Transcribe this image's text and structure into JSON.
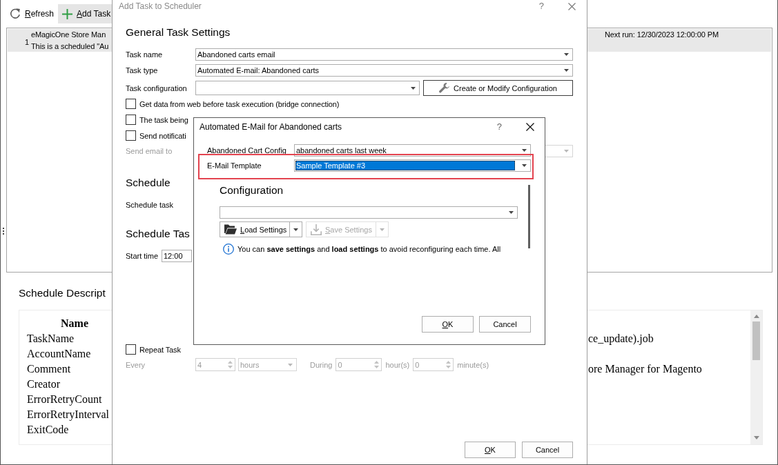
{
  "main_window": {
    "toolbar": [
      {
        "kind": "refresh",
        "label": "Refresh",
        "mnemonic": true,
        "pressed": false
      },
      {
        "kind": "add",
        "label": "Add Task",
        "mnemonic": true,
        "pressed": true
      }
    ],
    "task_list": [
      {
        "number": "1",
        "title": "eMagicOne Store Man",
        "description": "This is a scheduled \"Au",
        "next_run": "Next run: 12/30/2023 12:00:00 PM",
        "selected": true
      }
    ],
    "schedule_description": {
      "title": "Schedule Descript",
      "table": {
        "header": "Name",
        "rows": [
          {
            "name": "TaskName",
            "value": "ce_update).job"
          },
          {
            "name": "AccountName"
          },
          {
            "name": "Comment",
            "value": "ore Manager for Magento"
          },
          {
            "name": "Creator"
          },
          {
            "name": "ErrorRetryCount"
          },
          {
            "name": "ErrorRetryInterval"
          },
          {
            "name": "ExitCode"
          }
        ]
      }
    }
  },
  "scheduler_dialog": {
    "title": "Add Task to Scheduler",
    "help": "?",
    "heading": "General Task Settings",
    "fields": [
      {
        "kind": "dropdown",
        "label": "Task name",
        "value": "Abandoned carts email"
      },
      {
        "kind": "dropdown",
        "label": "Task type",
        "value": "Automated E-mail: Abandoned carts"
      },
      {
        "kind": "dropdown_button",
        "label": "Task configuration",
        "button": "Create or Modify Configuration"
      }
    ],
    "options": [
      {
        "label": "Get data from web before task execution (bridge connection)",
        "checked": false
      },
      {
        "label": "The task being",
        "checked": false
      },
      {
        "label": "Send notificati",
        "checked": false
      }
    ],
    "send_email": {
      "label": "Send email to",
      "disabled": true
    },
    "schedule": {
      "heading": "Schedule",
      "label": "Schedule task"
    },
    "schedule_task": {
      "heading": "Schedule Tas",
      "start_label": "Start time",
      "start_time": "12:00"
    },
    "repeat": {
      "label": "Repeat Task",
      "checked": false,
      "disabled": true,
      "every_label": "Every",
      "every": "4",
      "unit": "hours",
      "during_label": "During",
      "hours": "0",
      "hours_label": "hour(s)",
      "minutes": "0",
      "minutes_label": "minute(s)"
    },
    "buttons": [
      {
        "label": "OK",
        "mnemonic": true
      },
      {
        "label": "Cancel",
        "mnemonic": false
      }
    ]
  },
  "email_dialog": {
    "title": "Automated E-Mail for Abandoned carts",
    "help": "?",
    "fields": [
      {
        "label": "Abandoned Cart Config",
        "value": "abandoned carts last week",
        "focused": false,
        "highlighted": false
      },
      {
        "label": "E-Mail Template",
        "value": "Sample Template #3",
        "focused": true,
        "highlighted": true
      }
    ],
    "configuration": {
      "heading": "Configuration",
      "buttons": [
        {
          "kind": "load",
          "label": "Load Settings",
          "mnemonic": true,
          "disabled": false
        },
        {
          "kind": "save",
          "label": "Save Settings",
          "mnemonic": true,
          "disabled": true
        }
      ],
      "info": "You can **save settings** and **load settings** to avoid reconfiguring each time. All"
    },
    "buttons": [
      {
        "label": "OK",
        "mnemonic": true
      },
      {
        "label": "Cancel",
        "mnemonic": false
      }
    ]
  }
}
